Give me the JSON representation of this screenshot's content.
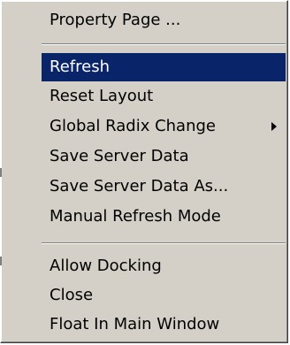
{
  "context_menu": {
    "items": [
      {
        "label": "Property Page ..."
      },
      {
        "label": "Refresh",
        "state": "highlighted"
      },
      {
        "label": "Reset Layout"
      },
      {
        "label": "Global Radix Change",
        "icon": "submenu-arrow-icon"
      },
      {
        "label": "Save Server Data"
      },
      {
        "label": "Save Server Data As..."
      },
      {
        "label": "Manual Refresh Mode"
      },
      {
        "label": "Allow Docking"
      },
      {
        "label": "Close"
      },
      {
        "label": "Float In Main Window"
      }
    ]
  },
  "colors": {
    "menu_background": "#d4d0c8",
    "highlight_background": "#0a246a",
    "highlight_text": "#ffffff",
    "text": "#000000"
  }
}
